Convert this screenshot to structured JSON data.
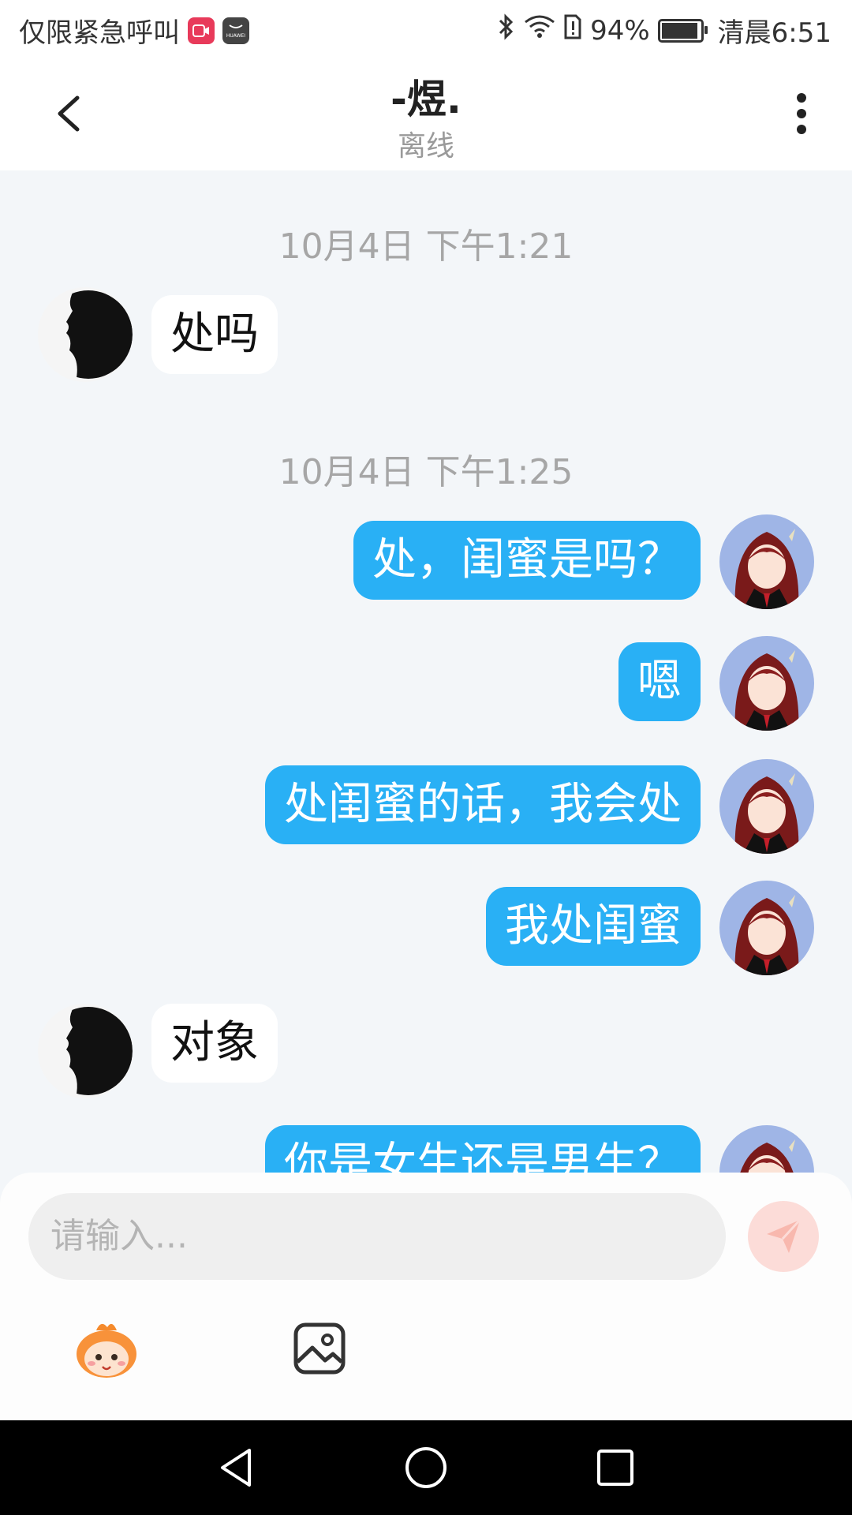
{
  "status_bar": {
    "left_text": "仅限紧急呼叫",
    "app_badge_2_text": "HUAWEI",
    "battery": "94%",
    "time": "清晨6:51",
    "battery_level": 0.94
  },
  "header": {
    "name": "-煜.",
    "status": "离线"
  },
  "chat": {
    "timestamps": [
      "10月4日 下午1:21",
      "10月4日 下午1:25"
    ],
    "messages": [
      {
        "side": "left",
        "text": "处吗"
      },
      {
        "side": "right",
        "text": "处，闺蜜是吗？"
      },
      {
        "side": "right",
        "text": "嗯"
      },
      {
        "side": "right",
        "text": "处闺蜜的话，我会处"
      },
      {
        "side": "right",
        "text": "我处闺蜜"
      },
      {
        "side": "left",
        "text": "对象"
      },
      {
        "side": "right",
        "text": "你是女生还是男生？"
      }
    ]
  },
  "composer": {
    "placeholder": "请输入..."
  },
  "icons": {
    "back": "back-arrow-icon",
    "more": "more-vertical-icon",
    "send": "send-icon",
    "emoji": "emoji-mascot-icon",
    "image": "image-icon"
  },
  "colors": {
    "bubble_right": "#29b0f5",
    "bubble_left": "#ffffff",
    "chat_bg": "#f3f6f9",
    "send_btn": "#fcdcd8"
  }
}
